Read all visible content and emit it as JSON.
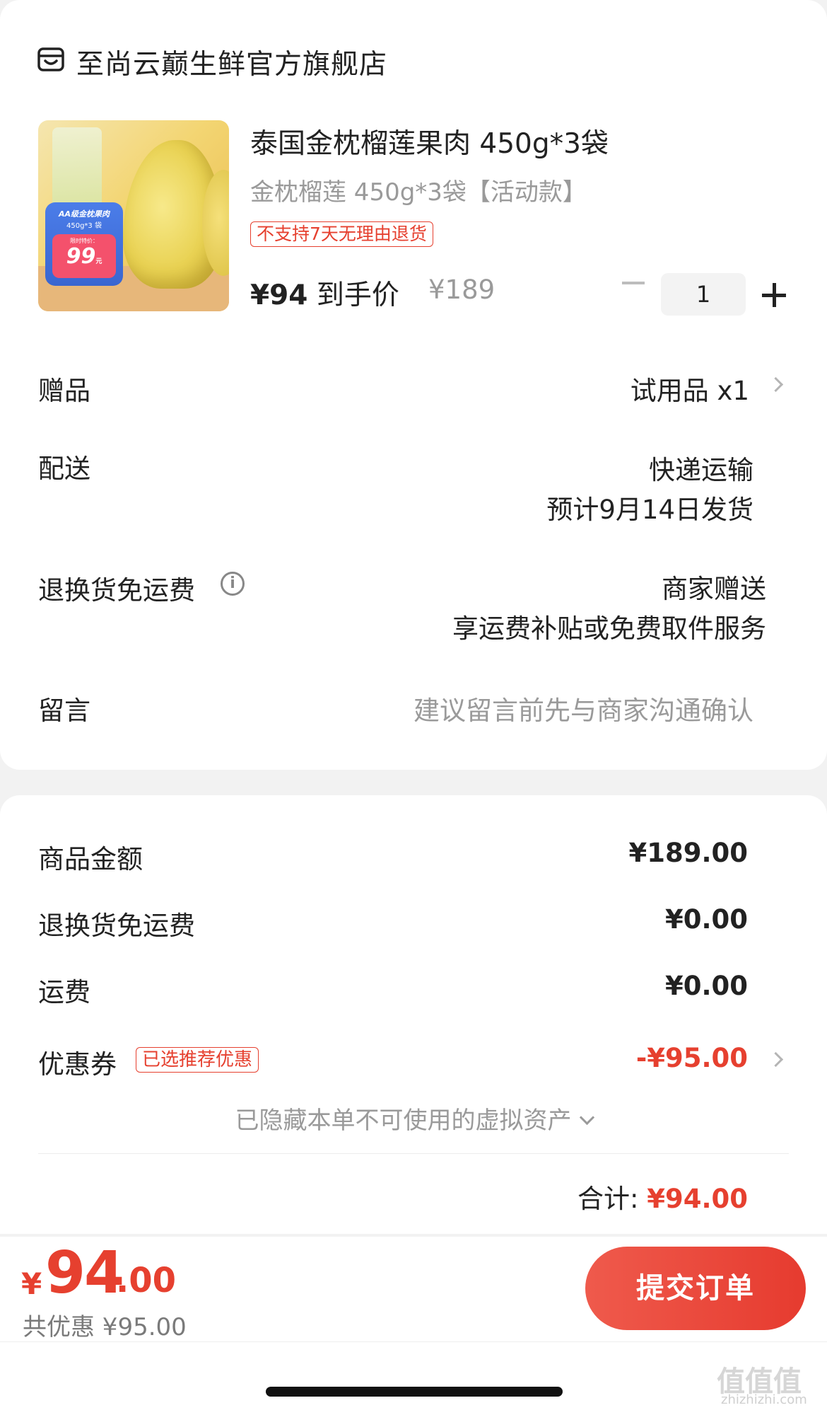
{
  "store": {
    "name": "至尚云巅生鲜官方旗舰店",
    "icon": "store-icon"
  },
  "product": {
    "title": "泰国金枕榴莲果肉 450g*3袋",
    "spec": "金枕榴莲 450g*3袋【活动款】",
    "return_policy": "不支持7天无理由退货",
    "price_final_value": "¥94",
    "price_final_label": " 到手价",
    "price_original": "¥189",
    "quantity": "1",
    "image_tag": {
      "title": "AA级金枕果肉",
      "spec": "450g*3 袋",
      "label": "限时特价：",
      "price": "99",
      "unit": "元"
    }
  },
  "rows": {
    "gift": {
      "label": "赠品",
      "value": "试用品 x1"
    },
    "delivery": {
      "label": "配送",
      "value_line1": "快递运输",
      "value_line2": "预计9月14日发货"
    },
    "return_shipping": {
      "label": "退换货免运费",
      "value_line1": "商家赠送",
      "value_line2": "享运费补贴或免费取件服务"
    },
    "message": {
      "label": "留言",
      "placeholder": "建议留言前先与商家沟通确认"
    }
  },
  "summary": {
    "goods_amount": {
      "label": "商品金额",
      "value": "¥189.00"
    },
    "return_fee": {
      "label": "退换货免运费",
      "value": "¥0.00"
    },
    "shipping": {
      "label": "运费",
      "value": "¥0.00"
    },
    "coupon": {
      "label": "优惠券",
      "badge": "已选推荐优惠",
      "value": "-¥95.00"
    },
    "hidden_assets": "已隐藏本单不可使用的虚拟资产",
    "total_label": "合计: ",
    "total_value": "¥94.00"
  },
  "footer": {
    "currency": "¥",
    "amount_int": "94",
    "amount_dec": ".00",
    "saved": "共优惠 ¥95.00",
    "submit_label": "提交订单"
  },
  "watermark": {
    "text": "值值值",
    "url": "zhizhizhi.com"
  },
  "colors": {
    "accent": "#e6402f",
    "muted": "#9a9a9a",
    "background": "#f2f2f2"
  }
}
